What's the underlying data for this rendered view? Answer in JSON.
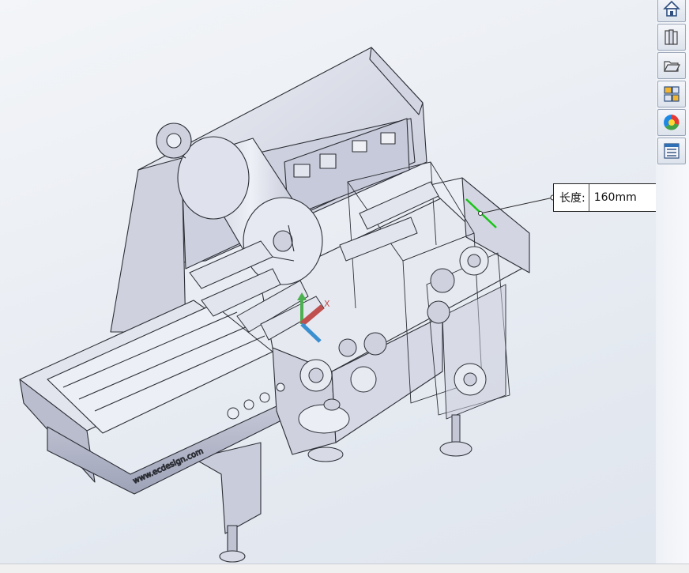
{
  "dimension": {
    "label": "长度:",
    "value": "160mm",
    "leader_color": "#2a2a2a",
    "highlight_edge_color": "#19c419"
  },
  "triad": {
    "x_label": "X",
    "x_color": "#c0504d",
    "y_color": "#4caf50",
    "z_color": "#3a8fd0"
  },
  "model": {
    "side_panel_text": "www.ecdesign.com"
  },
  "task_pane": {
    "tabs": [
      {
        "name": "home-icon"
      },
      {
        "name": "design-library-icon"
      },
      {
        "name": "file-explorer-icon"
      },
      {
        "name": "view-palette-icon"
      },
      {
        "name": "appearances-icon"
      },
      {
        "name": "custom-properties-icon"
      }
    ]
  },
  "colors": {
    "body_fill": "#d9dce8",
    "body_dark": "#b9bdcd",
    "edge": "#2d2f36",
    "roll_fill": "#dfe1ec"
  }
}
